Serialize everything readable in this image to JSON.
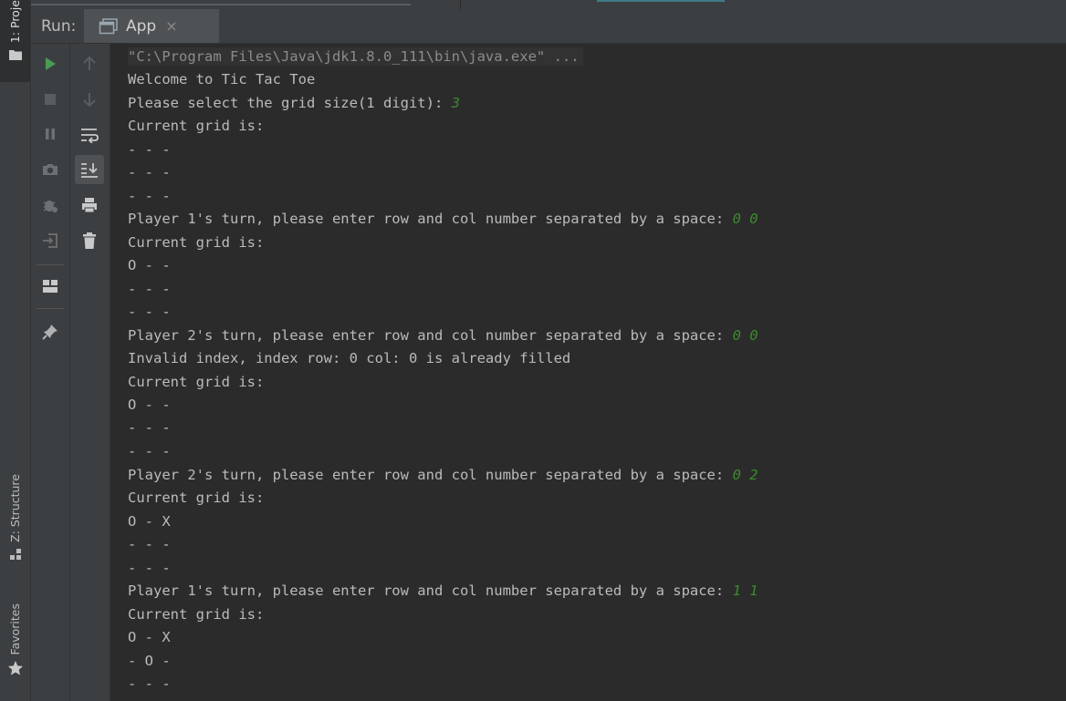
{
  "left_stripe": {
    "project_tab": "1: Proje",
    "structure_tab": "Z: Structure",
    "favorites_tab": "Favorites"
  },
  "run_panel": {
    "label": "Run:",
    "tab_title": "App",
    "tab_close": "×"
  },
  "toolbar_left": {
    "buttons": [
      "run-icon",
      "stop-icon",
      "pause-icon",
      "camera-icon",
      "debug-icon",
      "exit-icon",
      "layout-icon",
      "pin-icon"
    ]
  },
  "toolbar_right": {
    "buttons": [
      "arrow-up-icon",
      "arrow-down-icon",
      "soft-wrap-icon",
      "scroll-to-end-icon",
      "print-icon",
      "trash-icon"
    ]
  },
  "console": {
    "lines": [
      {
        "text": "\"C:\\Program Files\\Java\\jdk1.8.0_111\\bin\\java.exe\" ...",
        "input": ""
      },
      {
        "text": "Welcome to Tic Tac Toe",
        "input": ""
      },
      {
        "text": "Please select the grid size(1 digit): ",
        "input": "3"
      },
      {
        "text": "Current grid is:",
        "input": ""
      },
      {
        "text": "- - -",
        "input": ""
      },
      {
        "text": "- - -",
        "input": ""
      },
      {
        "text": "- - -",
        "input": ""
      },
      {
        "text": "Player 1's turn, please enter row and col number separated by a space: ",
        "input": "0 0"
      },
      {
        "text": "Current grid is:",
        "input": ""
      },
      {
        "text": "O - -",
        "input": ""
      },
      {
        "text": "- - -",
        "input": ""
      },
      {
        "text": "- - -",
        "input": ""
      },
      {
        "text": "Player 2's turn, please enter row and col number separated by a space: ",
        "input": "0 0"
      },
      {
        "text": "Invalid index, index row: 0 col: 0 is already filled",
        "input": ""
      },
      {
        "text": "Current grid is:",
        "input": ""
      },
      {
        "text": "O - -",
        "input": ""
      },
      {
        "text": "- - -",
        "input": ""
      },
      {
        "text": "- - -",
        "input": ""
      },
      {
        "text": "Player 2's turn, please enter row and col number separated by a space: ",
        "input": "0 2"
      },
      {
        "text": "Current grid is:",
        "input": ""
      },
      {
        "text": "O - X",
        "input": ""
      },
      {
        "text": "- - -",
        "input": ""
      },
      {
        "text": "- - -",
        "input": ""
      },
      {
        "text": "Player 1's turn, please enter row and col number separated by a space: ",
        "input": "1 1"
      },
      {
        "text": "Current grid is:",
        "input": ""
      },
      {
        "text": "O - X",
        "input": ""
      },
      {
        "text": "- O -",
        "input": ""
      },
      {
        "text": "- - -",
        "input": ""
      }
    ]
  },
  "colors": {
    "input_text": "#3b8a2e",
    "run_green": "#499c54",
    "console_bg": "#2b2b2b",
    "panel_bg": "#3c3f41"
  }
}
